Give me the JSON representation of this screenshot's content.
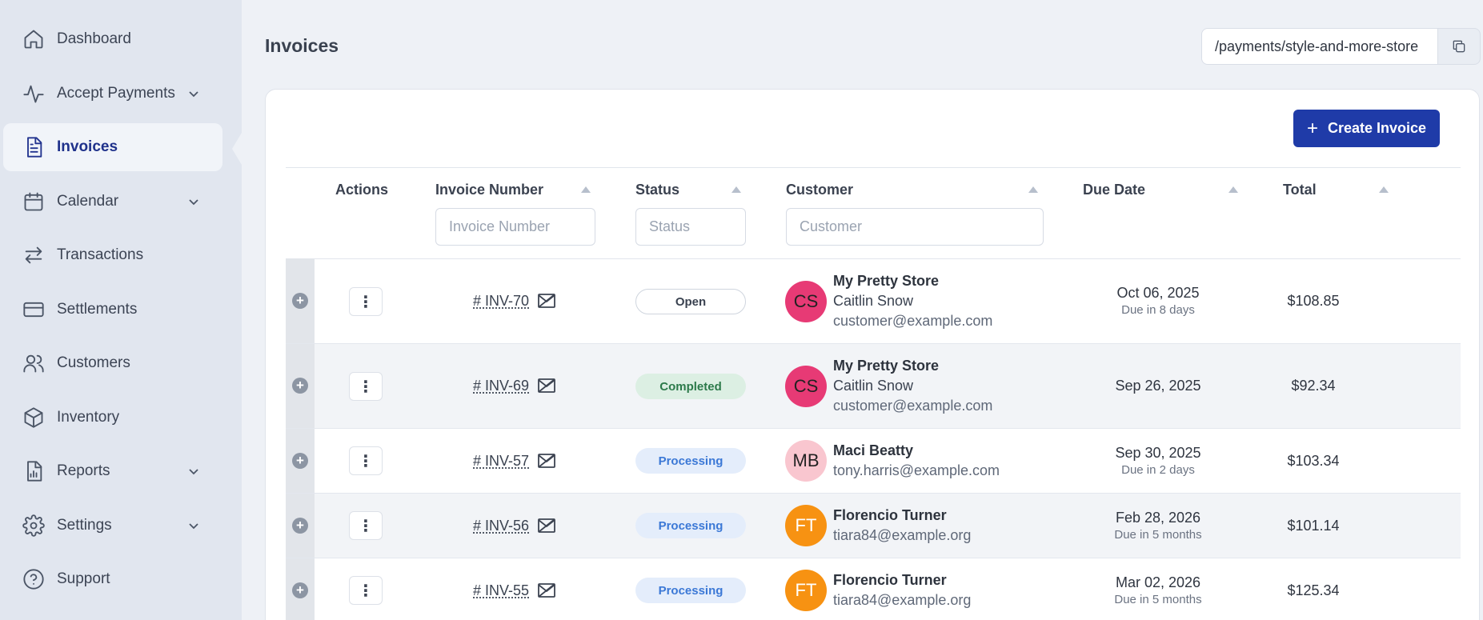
{
  "sidebar": {
    "items": [
      {
        "label": "Dashboard",
        "icon": "home-icon"
      },
      {
        "label": "Accept Payments",
        "icon": "activity-icon"
      },
      {
        "label": "Invoices",
        "icon": "document-icon"
      },
      {
        "label": "Calendar",
        "icon": "calendar-icon"
      },
      {
        "label": "Transactions",
        "icon": "transfer-arrows-icon"
      },
      {
        "label": "Settlements",
        "icon": "credit-card-icon"
      },
      {
        "label": "Customers",
        "icon": "users-icon"
      },
      {
        "label": "Inventory",
        "icon": "box-icon"
      },
      {
        "label": "Reports",
        "icon": "report-icon"
      },
      {
        "label": "Settings",
        "icon": "gear-icon"
      },
      {
        "label": "Support",
        "icon": "help-icon"
      }
    ]
  },
  "header": {
    "title": "Invoices",
    "payment_url": "/payments/style-and-more-store"
  },
  "toolbar": {
    "create_label": "Create Invoice"
  },
  "table": {
    "columns": [
      "Actions",
      "Invoice Number",
      "Status",
      "Customer",
      "Due Date",
      "Total"
    ],
    "filters": {
      "invoice_number_placeholder": "Invoice Number",
      "status_placeholder": "Status",
      "customer_placeholder": "Customer"
    },
    "rows": [
      {
        "invoice": "# INV-70",
        "status": "Open",
        "initials": "CS",
        "company": "My Pretty Store",
        "contact": "Caitlin Snow",
        "email": "customer@example.com",
        "due_date": "Oct 06, 2025",
        "due_note": "Due in 8 days",
        "total": "$108.85"
      },
      {
        "invoice": "# INV-69",
        "status": "Completed",
        "initials": "CS",
        "company": "My Pretty Store",
        "contact": "Caitlin Snow",
        "email": "customer@example.com",
        "due_date": "Sep 26, 2025",
        "due_note": "",
        "total": "$92.34"
      },
      {
        "invoice": "# INV-57",
        "status": "Processing",
        "initials": "MB",
        "company": "Maci Beatty",
        "contact": "",
        "email": "tony.harris@example.com",
        "due_date": "Sep 30, 2025",
        "due_note": "Due in 2 days",
        "total": "$103.34"
      },
      {
        "invoice": "# INV-56",
        "status": "Processing",
        "initials": "FT",
        "company": "Florencio Turner",
        "contact": "",
        "email": "tiara84@example.org",
        "due_date": "Feb 28, 2026",
        "due_note": "Due in 5 months",
        "total": "$101.14"
      },
      {
        "invoice": "# INV-55",
        "status": "Processing",
        "initials": "FT",
        "company": "Florencio Turner",
        "contact": "",
        "email": "tiara84@example.org",
        "due_date": "Mar 02, 2026",
        "due_note": "Due in 5 months",
        "total": "$125.34"
      }
    ]
  },
  "colors": {
    "accent": "#1f3ba8",
    "sidebar_bg": "#e1e6ef",
    "open": "#ffffff",
    "completed": "#dcefe3",
    "processing": "#e4edfb",
    "avatar_pink": "#e73a75",
    "avatar_lightpink": "#f9c6cf",
    "avatar_orange": "#f79212"
  }
}
